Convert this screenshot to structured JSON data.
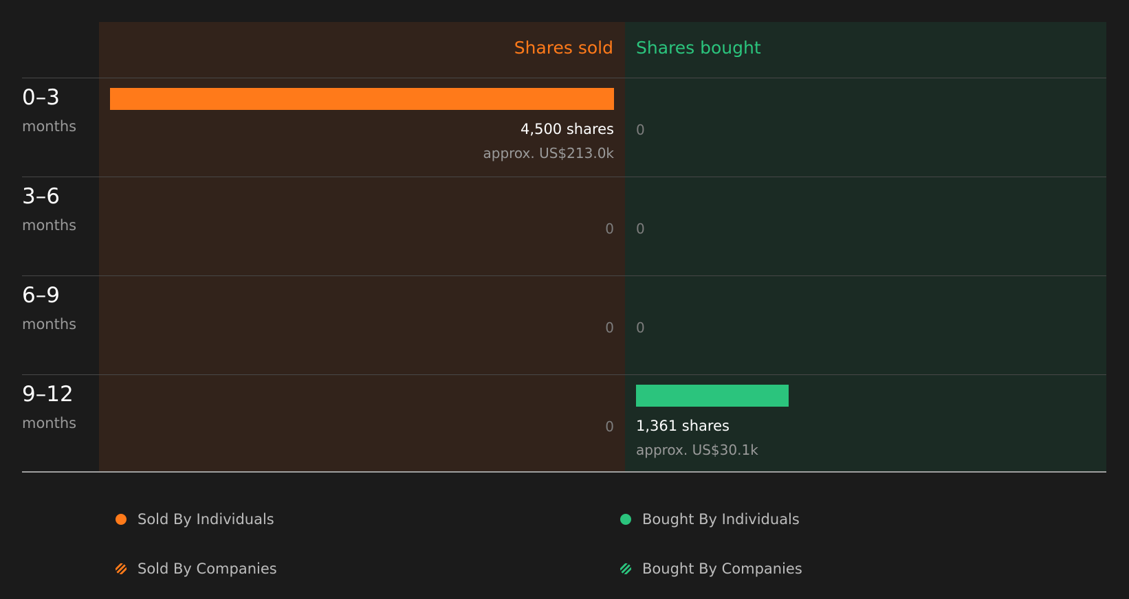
{
  "chart_data": {
    "type": "bar",
    "title": "",
    "column_headers": {
      "sold": "Shares sold",
      "bought": "Shares bought"
    },
    "categories": [
      {
        "period": "0–3",
        "unit": "months"
      },
      {
        "period": "3–6",
        "unit": "months"
      },
      {
        "period": "6–9",
        "unit": "months"
      },
      {
        "period": "9–12",
        "unit": "months"
      }
    ],
    "series": [
      {
        "name": "Shares sold",
        "values": [
          4500,
          0,
          0,
          0
        ],
        "labels": [
          "4,500 shares",
          "0",
          "0",
          "0"
        ],
        "approx": [
          "approx. US$213.0k",
          "",
          "",
          ""
        ]
      },
      {
        "name": "Shares bought",
        "values": [
          0,
          0,
          0,
          1361
        ],
        "labels": [
          "0",
          "0",
          "0",
          "1,361 shares"
        ],
        "approx": [
          "",
          "",
          "",
          "approx. US$30.1k"
        ]
      }
    ],
    "max_value": 4500,
    "legend": {
      "placement": "bottom",
      "items": [
        {
          "label": "Sold By Individuals",
          "style": "dot",
          "color": "#ff7a1a"
        },
        {
          "label": "Bought By Individuals",
          "style": "dot",
          "color": "#2bc47d"
        },
        {
          "label": "Sold By Companies",
          "style": "hatch",
          "color": "#ff7a1a"
        },
        {
          "label": "Bought By Companies",
          "style": "hatch",
          "color": "#2bc47d"
        }
      ]
    },
    "colors": {
      "sold": "#ff7a1a",
      "bought": "#2bc47d"
    }
  }
}
